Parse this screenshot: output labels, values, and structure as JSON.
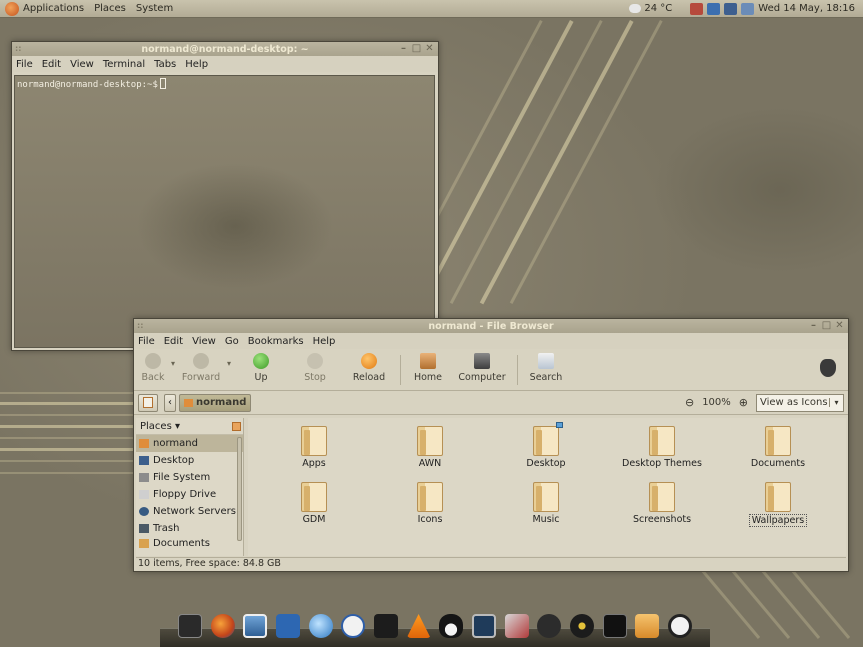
{
  "top_panel": {
    "menus": [
      "Applications",
      "Places",
      "System"
    ],
    "weather": "24 °C",
    "datetime": "Wed 14 May, 18:16",
    "tray_icons": [
      "network-icon",
      "bluetooth-icon",
      "display-icon",
      "mail-icon"
    ]
  },
  "terminal": {
    "title": "normand@normand-desktop: ~",
    "menu": [
      "File",
      "Edit",
      "View",
      "Terminal",
      "Tabs",
      "Help"
    ],
    "prompt": "normand@normand-desktop:~$"
  },
  "file_browser": {
    "title": "normand - File Browser",
    "menu": [
      "File",
      "Edit",
      "View",
      "Go",
      "Bookmarks",
      "Help"
    ],
    "toolbar": {
      "back": "Back",
      "forward": "Forward",
      "up": "Up",
      "stop": "Stop",
      "reload": "Reload",
      "home": "Home",
      "computer": "Computer",
      "search": "Search"
    },
    "location": {
      "crumb": "normand",
      "zoom": "100%",
      "view_mode": "View as Icons"
    },
    "sidebar": {
      "header": "Places",
      "items": [
        {
          "label": "normand",
          "icon": "home-folder-icon",
          "selected": true
        },
        {
          "label": "Desktop",
          "icon": "desktop-icon"
        },
        {
          "label": "File System",
          "icon": "filesystem-icon"
        },
        {
          "label": "Floppy Drive",
          "icon": "floppy-icon"
        },
        {
          "label": "Network Servers",
          "icon": "network-icon"
        },
        {
          "label": "Trash",
          "icon": "trash-icon"
        },
        {
          "label": "Documents",
          "icon": "documents-icon"
        }
      ]
    },
    "folders": [
      {
        "label": "Apps"
      },
      {
        "label": "AWN"
      },
      {
        "label": "Desktop",
        "emblem": true
      },
      {
        "label": "Desktop Themes"
      },
      {
        "label": "Documents"
      },
      {
        "label": "GDM"
      },
      {
        "label": "Icons"
      },
      {
        "label": "Music"
      },
      {
        "label": "Screenshots"
      },
      {
        "label": "Wallpapers",
        "focused": true
      }
    ],
    "status": "10 items, Free space: 84.8 GB"
  },
  "dock": {
    "icons": [
      "terminal-icon",
      "firefox-icon",
      "image-viewer-icon",
      "word-processor-icon",
      "browser-icon",
      "bluetooth-icon",
      "video-editor-icon",
      "vlc-icon",
      "linux-penguin-icon",
      "system-monitor-icon",
      "package-manager-icon",
      "webcam-icon",
      "media-player-icon",
      "monitor-icon",
      "file-manager-icon",
      "power-icon"
    ]
  },
  "colors": {
    "panel": "#c9c3ad",
    "window_bg": "#d8d3c1",
    "folder": "#f6e7c4",
    "selection": "#bdb59b"
  }
}
